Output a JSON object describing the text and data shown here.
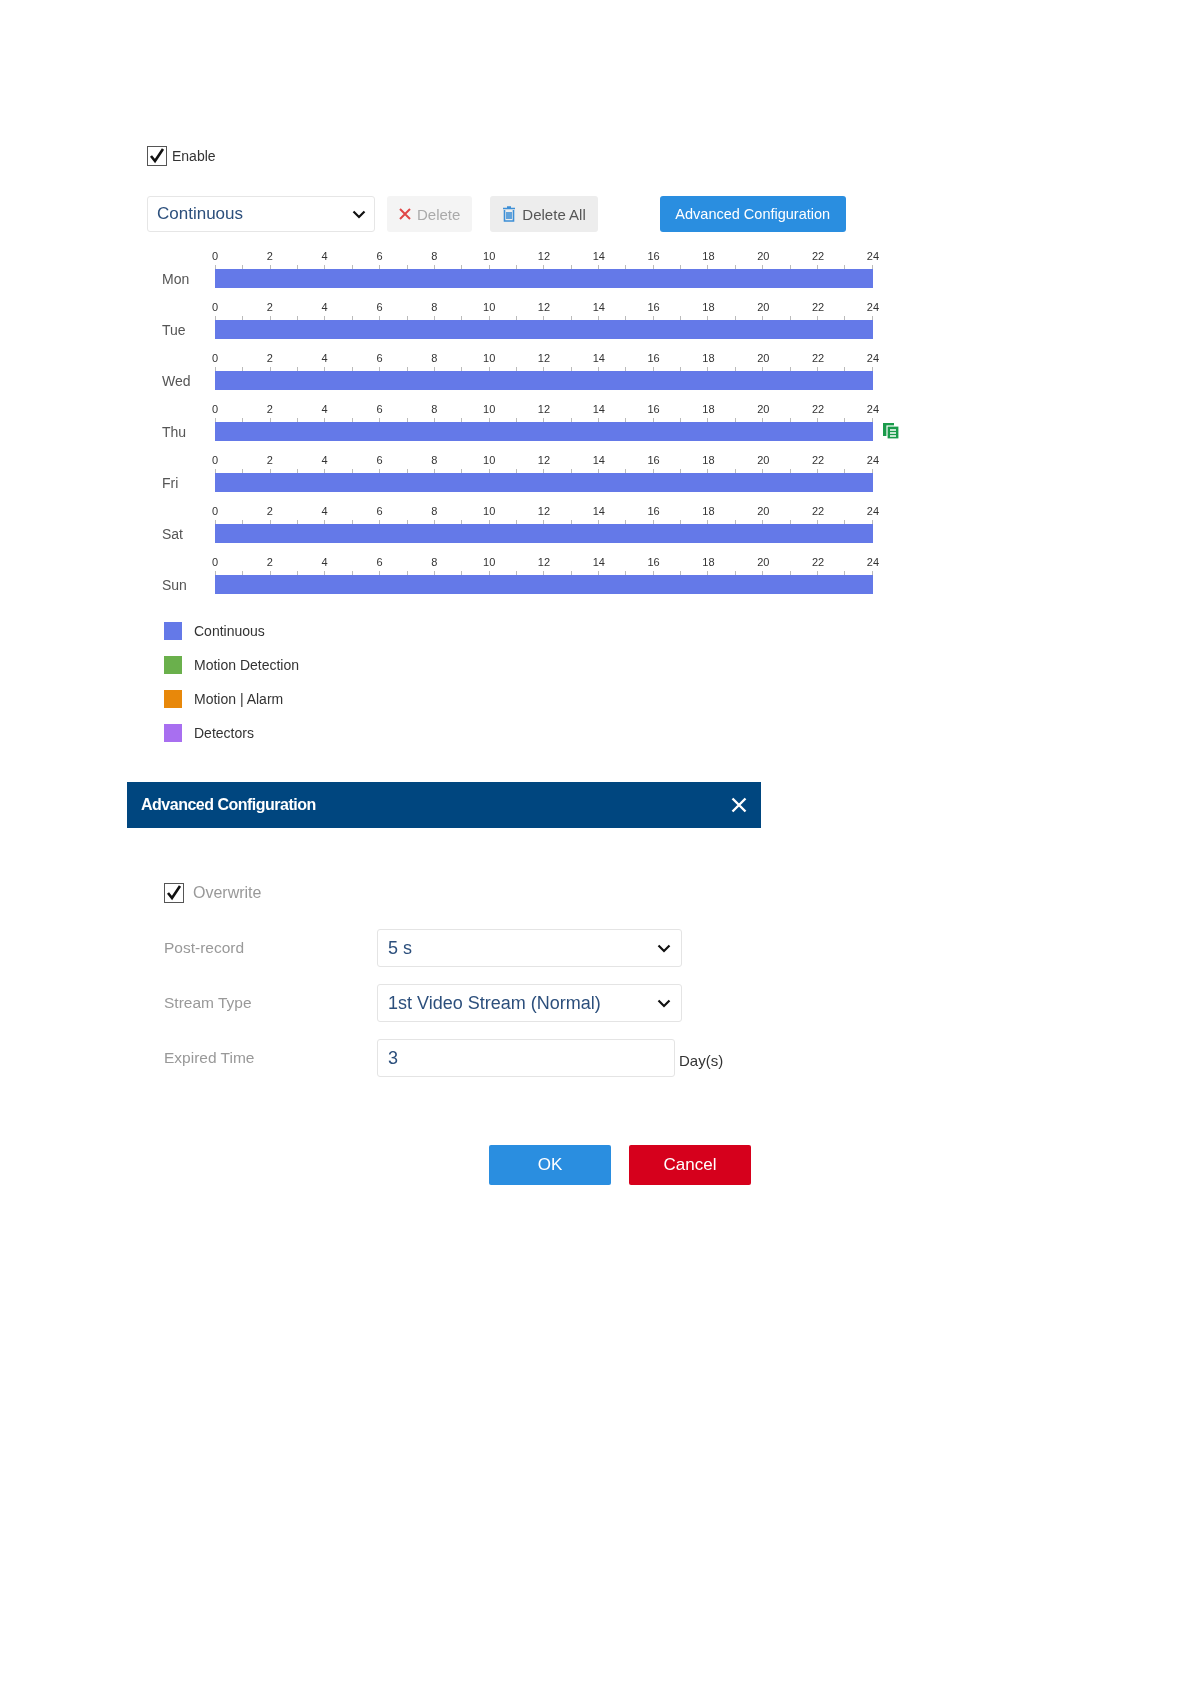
{
  "enable": {
    "label": "Enable",
    "checked": true
  },
  "toolbar": {
    "mode": "Continuous",
    "delete": "Delete",
    "delete_disabled": true,
    "delete_all": "Delete All",
    "advanced": "Advanced Configuration"
  },
  "days": [
    {
      "label": "Mon",
      "kind": "continuous",
      "copy_icon": false,
      "ticks": [
        "0",
        "2",
        "4",
        "6",
        "8",
        "10",
        "12",
        "14",
        "16",
        "18",
        "20",
        "22",
        "24"
      ]
    },
    {
      "label": "Tue",
      "kind": "continuous",
      "copy_icon": false,
      "ticks": [
        "0",
        "2",
        "4",
        "6",
        "8",
        "10",
        "12",
        "14",
        "16",
        "18",
        "20",
        "22",
        "24"
      ]
    },
    {
      "label": "Wed",
      "kind": "continuous",
      "copy_icon": false,
      "ticks": [
        "0",
        "2",
        "4",
        "6",
        "8",
        "10",
        "12",
        "14",
        "16",
        "18",
        "20",
        "22",
        "24"
      ]
    },
    {
      "label": "Thu",
      "kind": "continuous",
      "copy_icon": true,
      "ticks": [
        "0",
        "2",
        "4",
        "6",
        "8",
        "10",
        "12",
        "14",
        "16",
        "18",
        "20",
        "22",
        "24"
      ]
    },
    {
      "label": "Fri",
      "kind": "continuous",
      "copy_icon": false,
      "ticks": [
        "0",
        "2",
        "4",
        "6",
        "8",
        "10",
        "12",
        "14",
        "16",
        "18",
        "20",
        "22",
        "24"
      ]
    },
    {
      "label": "Sat",
      "kind": "continuous",
      "copy_icon": false,
      "ticks": [
        "0",
        "2",
        "4",
        "6",
        "8",
        "10",
        "12",
        "14",
        "16",
        "18",
        "20",
        "22",
        "24"
      ]
    },
    {
      "label": "Sun",
      "kind": "continuous",
      "copy_icon": false,
      "ticks": [
        "0",
        "2",
        "4",
        "6",
        "8",
        "10",
        "12",
        "14",
        "16",
        "18",
        "20",
        "22",
        "24"
      ]
    }
  ],
  "legend": [
    {
      "label": "Continuous",
      "kind": "continuous",
      "color": "#6479e8"
    },
    {
      "label": "Motion Detection",
      "kind": "motion",
      "color": "#6ab04c"
    },
    {
      "label": "Motion | Alarm",
      "kind": "alarm",
      "color": "#e8880a"
    },
    {
      "label": "Detectors",
      "kind": "detectors",
      "color": "#a86ff0"
    }
  ],
  "dialog": {
    "title": "Advanced Configuration",
    "overwrite": {
      "label": "Overwrite",
      "checked": true
    },
    "fields": [
      {
        "label": "Post-record",
        "kind": "select",
        "value": "5 s"
      },
      {
        "label": "Stream Type",
        "kind": "select",
        "value": "1st Video Stream (Normal)"
      },
      {
        "label": "Expired Time",
        "kind": "input",
        "value": "3",
        "unit": "Day(s)"
      }
    ],
    "ok": "OK",
    "cancel": "Cancel"
  }
}
